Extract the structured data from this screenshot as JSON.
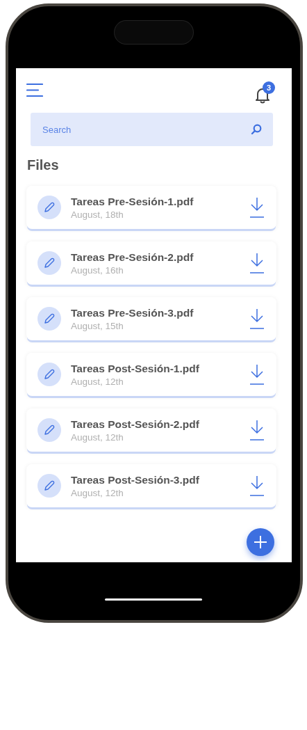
{
  "header": {
    "notification_count": "3"
  },
  "search": {
    "placeholder": "Search"
  },
  "section_title": "Files",
  "files": [
    {
      "name": "Tareas Pre-Sesión-1.pdf",
      "date": "August, 18th"
    },
    {
      "name": "Tareas Pre-Sesión-2.pdf",
      "date": "August, 16th"
    },
    {
      "name": "Tareas Pre-Sesión-3.pdf",
      "date": "August, 15th"
    },
    {
      "name": "Tareas Post-Sesión-1.pdf",
      "date": "August, 12th"
    },
    {
      "name": "Tareas Post-Sesión-2.pdf",
      "date": "August, 12th"
    },
    {
      "name": "Tareas Post-Sesión-3.pdf",
      "date": "August, 12th"
    }
  ]
}
